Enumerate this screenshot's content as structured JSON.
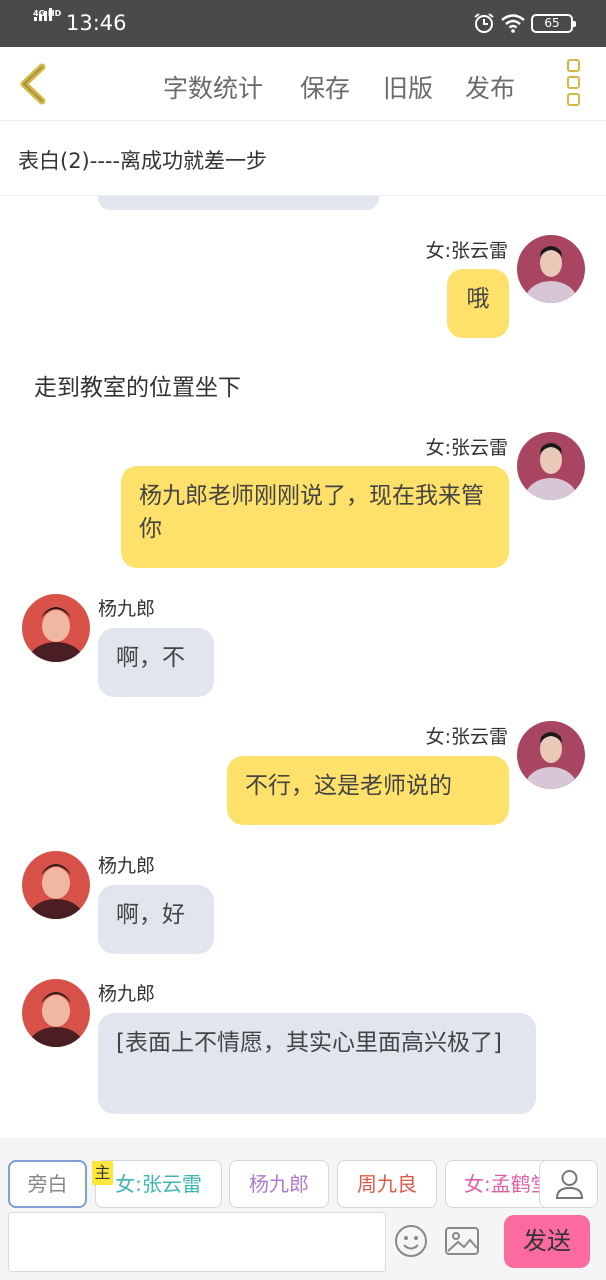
{
  "status_bar": {
    "network": "4G HD",
    "time": "13:46",
    "battery": "65"
  },
  "nav": {
    "word_count": "字数统计",
    "save": "保存",
    "old_version": "旧版",
    "publish": "发布"
  },
  "chapter_title": "表白(2)----离成功就差一步",
  "messages": [
    {
      "side": "right",
      "name": "女:张云雷",
      "text": "哦"
    },
    {
      "side": "narration",
      "text": "走到教室的位置坐下"
    },
    {
      "side": "right",
      "name": "女:张云雷",
      "text": "杨九郎老师刚刚说了，现在我来管你"
    },
    {
      "side": "left",
      "name": "杨九郎",
      "text": "啊，不"
    },
    {
      "side": "right",
      "name": "女:张云雷",
      "text": "不行，这是老师说的"
    },
    {
      "side": "left",
      "name": "杨九郎",
      "text": "啊，好"
    },
    {
      "side": "left",
      "name": "杨九郎",
      "text": "[表面上不情愿，其实心里面高兴极了]"
    }
  ],
  "characters": [
    {
      "label": "旁白",
      "color": "#888888"
    },
    {
      "label": "女:张云雷",
      "color": "#3fb6b0"
    },
    {
      "label": "杨九郎",
      "color": "#b07bd0"
    },
    {
      "label": "周九良",
      "color": "#e05a4a"
    },
    {
      "label": "女:孟鹤堂",
      "color": "#e25fa6"
    }
  ],
  "host_badge": "主",
  "input": {
    "value": "",
    "placeholder": ""
  },
  "send_label": "发送",
  "colors": {
    "right_bubble": "#fde16a",
    "left_bubble": "#e1e6ee",
    "send_button": "#fc6ba0",
    "back_icon": "#d4b846"
  }
}
